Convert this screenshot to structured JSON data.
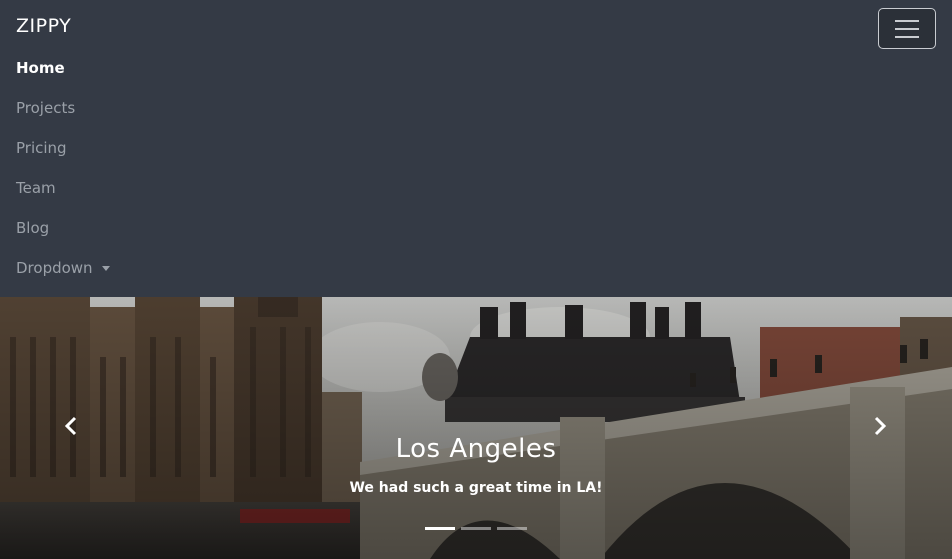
{
  "brand": "ZIPPY",
  "nav": {
    "items": [
      {
        "label": "Home",
        "active": true
      },
      {
        "label": "Projects"
      },
      {
        "label": "Pricing"
      },
      {
        "label": "Team"
      },
      {
        "label": "Blog"
      },
      {
        "label": "Dropdown",
        "has_dropdown": true
      }
    ]
  },
  "icons": {
    "toggler": "hamburger-menu-icon",
    "prev": "chevron-left-icon",
    "next": "chevron-right-icon",
    "dropdown": "caret-down-icon"
  },
  "carousel": {
    "title": "Los Angeles",
    "subtitle": "We had such a great time in LA!",
    "slides": 3,
    "active_slide": 1
  },
  "colors": {
    "navbar_bg": "#343a45",
    "nav_active": "#ffffff",
    "nav_inactive": "#9aa0a8"
  }
}
